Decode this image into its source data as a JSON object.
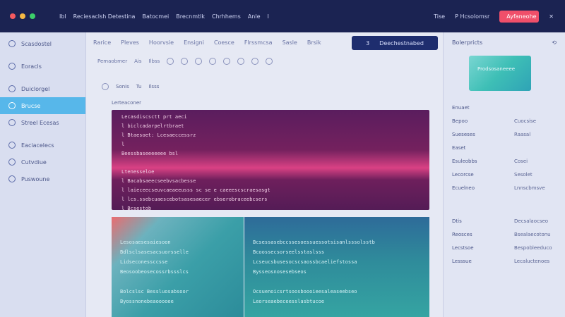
{
  "titlebar": {
    "menu": [
      "Ibl",
      "Reciesaclsh Detestina",
      "Batocmei",
      "Brecnmtlk",
      "Chrhhems",
      "Anle",
      "I"
    ],
    "right": [
      "Tise",
      "P Hcsolomsr"
    ],
    "cta": "Ayfaneohe",
    "close": "✕"
  },
  "sidebar": {
    "items": [
      {
        "label": "Scasdostel",
        "icon": "layers-icon"
      },
      {
        "label": "Eoracls",
        "icon": "chart-icon"
      },
      {
        "label": "Duiclorgel",
        "icon": "list-icon"
      },
      {
        "label": "Brucse",
        "icon": "sphere-icon"
      },
      {
        "label": "Streel Ecesas",
        "icon": "gear-icon"
      },
      {
        "label": "Eaciacelecs",
        "icon": "power-icon"
      },
      {
        "label": "Cutvdiue",
        "icon": "grid-icon"
      },
      {
        "label": "Puswoune",
        "icon": "stack-icon"
      }
    ],
    "active_index": 3
  },
  "main": {
    "tabs": [
      "Rarice",
      "Pleves",
      "Hoorvsie",
      "Ensigni",
      "Coesce",
      "Flrssmcsa",
      "Sasle",
      "Brsik"
    ],
    "cta": {
      "num": "3",
      "label": "Deechestnabed"
    },
    "tools": [
      "Pemaobmer",
      "Ais",
      "Ilbss"
    ],
    "crumbs": [
      "Sonis",
      "Tu",
      "Ilsss"
    ],
    "pane_heading": "Lerteaconer",
    "code1": [
      "Lecasdiscsctt prt aeci",
      "l   biclcadarpelrtbraet",
      "l   Btaesoet: Lcesaeccessrz",
      "l",
      "     Beessbaseeeeeee    bsl",
      "",
      "     Ltenesseloe",
      "  l  Bacabsaeecseebvsacbesse",
      "   l   laieceecseuvcaeaeeusss  sc se e caeeescscraesasgt",
      "l   lcs.ssebcuaescebotsasesaecer ebserobraceebcsers",
      "     l   Bcsestob"
    ],
    "code2": [
      "Lesosaesesaiesoon",
      "Bdlsclsasesacsuorsselle",
      "Lidseconessccsse",
      "Beosoobeosecossrbssslcs",
      "",
      "Bolcslsc  Bessluosabsoor",
      "Byossnonebeaooooee"
    ],
    "code3": [
      "Bcsessasebccssesoessuessotsisanlsssolsstb",
      "Bcoossecsorseelsstaslsss",
      "Lcseucsbusesocscsaossbcaeliefstossa",
      "Bysseosnosesebseos",
      "",
      "Ocsuenoicsrtsoosboooieesaleaseebseo",
      "Leorseaebeceesslasbtucoe"
    ]
  },
  "rpanel": {
    "title": "Bolerpricts",
    "preview_label": "Prodsosaneeee",
    "props": [
      {
        "k": "Enuaet",
        "v": ""
      },
      {
        "k": "Bepoo",
        "v": "Cuocsise"
      },
      {
        "k": "Sueseses",
        "v": "Raasal"
      },
      {
        "k": "Easet",
        "v": ""
      },
      {
        "k": "Esuleobbs",
        "v": "Cosei"
      },
      {
        "k": "Lecorcse",
        "v": "Sesolet"
      },
      {
        "k": "Ecuelneo",
        "v": "Lnnscbmsve"
      },
      {
        "k": "",
        "v": ""
      },
      {
        "k": "Dtis",
        "v": "Decsalaocseo"
      },
      {
        "k": "Reosces",
        "v": "Bsealaecotonu"
      },
      {
        "k": "Lecstsoe",
        "v": "Bespobleeduco"
      },
      {
        "k": "Lesssue",
        "v": "Lecaluctenoes"
      }
    ]
  }
}
